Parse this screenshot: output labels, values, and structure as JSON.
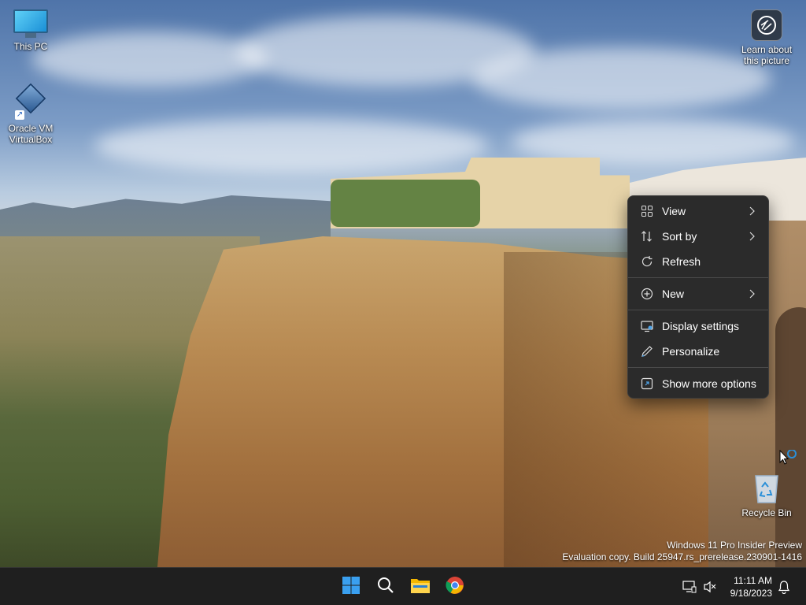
{
  "desktop": {
    "icons": [
      {
        "label": "This PC",
        "icon": "this-pc-icon"
      },
      {
        "label": "Oracle VM VirtualBox",
        "icon": "virtualbox-icon"
      },
      {
        "label": "Learn about this picture",
        "icon": "camera-icon"
      },
      {
        "label": "Recycle Bin",
        "icon": "recycle-bin-icon"
      }
    ]
  },
  "context_menu": {
    "items": [
      {
        "label": "View",
        "icon": "view-grid-icon",
        "submenu": true
      },
      {
        "label": "Sort by",
        "icon": "sort-icon",
        "submenu": true
      },
      {
        "label": "Refresh",
        "icon": "refresh-icon",
        "submenu": false
      },
      {
        "label": "New",
        "icon": "new-plus-icon",
        "submenu": true
      },
      {
        "label": "Display settings",
        "icon": "display-settings-icon",
        "submenu": false
      },
      {
        "label": "Personalize",
        "icon": "pencil-icon",
        "submenu": false
      },
      {
        "label": "Show more options",
        "icon": "show-more-icon",
        "submenu": false
      }
    ]
  },
  "watermark": {
    "line1": "Windows 11 Pro Insider Preview",
    "line2": "Evaluation copy. Build 25947.rs_prerelease.230901-1416"
  },
  "taskbar": {
    "apps": [
      "start-icon",
      "search-icon",
      "file-explorer-icon",
      "chrome-icon"
    ],
    "tray": [
      "network-icon",
      "volume-muted-icon"
    ],
    "time": "11:11 AM",
    "date": "9/18/2023",
    "notification_icon": "bell-icon"
  },
  "colors": {
    "menu_bg": "#2b2b2b",
    "taskbar_bg": "#1f1f1f",
    "accent": "#0078d4"
  }
}
